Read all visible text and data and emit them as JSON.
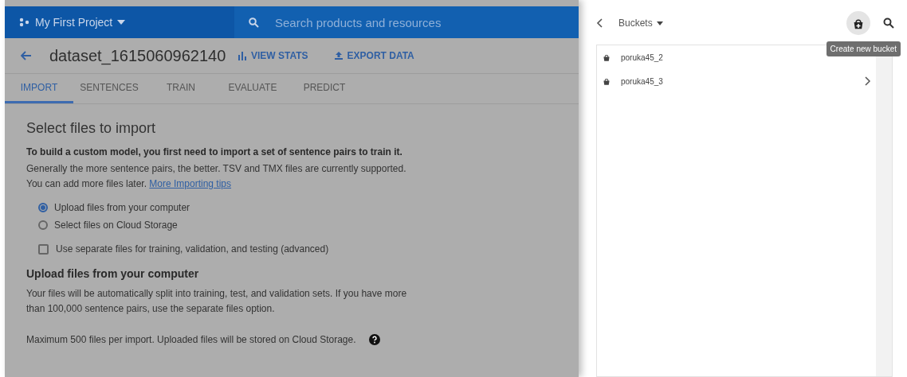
{
  "top_bar": {
    "project": "My First Project",
    "search_placeholder": "Search products and resources"
  },
  "header": {
    "title": "dataset_1615060962140",
    "actions": [
      {
        "kind": "stats",
        "label": "VIEW STATS"
      },
      {
        "kind": "export",
        "label": "EXPORT DATA"
      }
    ]
  },
  "tabs": [
    {
      "label": "IMPORT",
      "selected": true
    },
    {
      "label": "SENTENCES",
      "selected": false
    },
    {
      "label": "TRAIN",
      "selected": false
    },
    {
      "label": "EVALUATE",
      "selected": false
    },
    {
      "label": "PREDICT",
      "selected": false
    }
  ],
  "import": {
    "heading": "Select files to import",
    "lead": "To build a custom model, you first need to import a set of sentence pairs to train it.",
    "body": "Generally the more sentence pairs, the better. TSV and TMX files are currently supported. You can add more files later.",
    "link": "More Importing tips",
    "options": [
      {
        "label": "Upload files from your computer",
        "selected": true
      },
      {
        "label": "Select files on Cloud Storage",
        "selected": false
      }
    ],
    "separate": {
      "label": "Use separate files for training, validation, and testing (advanced)",
      "checked": false
    },
    "upload_heading": "Upload files from your computer",
    "upload_body": "Your files will be automatically split into training, test, and validation sets. If you have more than 100,000 sentence pairs, use the separate files option.",
    "limit": "Maximum 500 files per import. Uploaded files will be stored on Cloud Storage."
  },
  "panel": {
    "title": "Buckets",
    "tooltip": "Create new bucket",
    "buckets": [
      {
        "name": "poruka45_2",
        "chevron": false
      },
      {
        "name": "poruka45_3",
        "chevron": true
      }
    ]
  }
}
